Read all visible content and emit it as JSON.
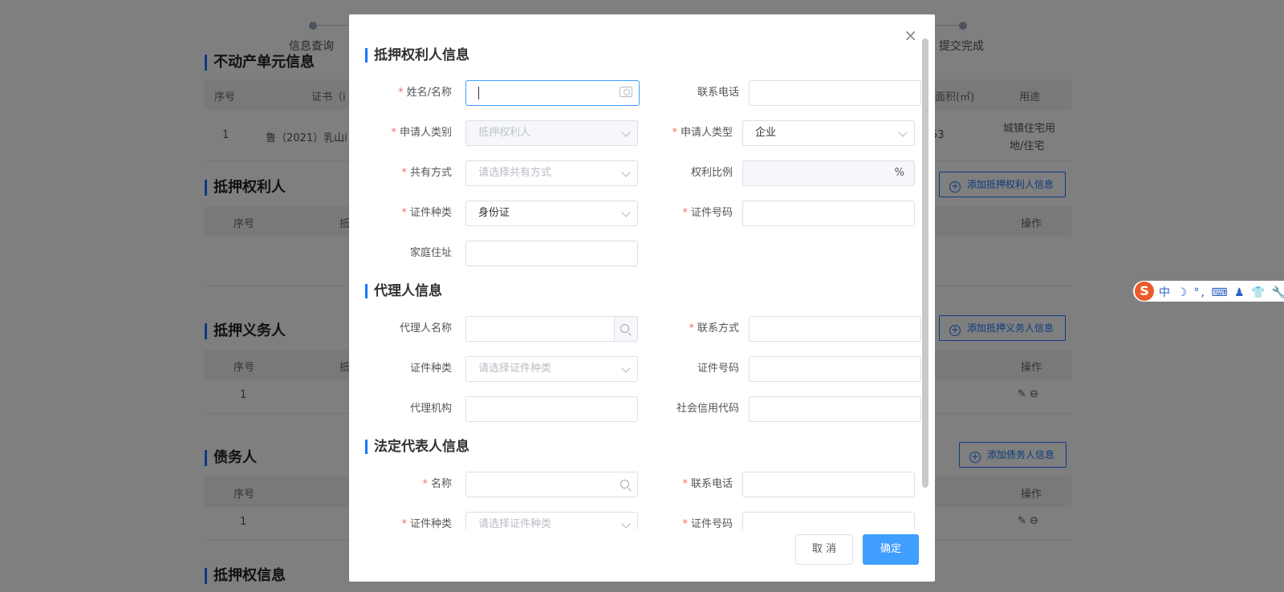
{
  "background": {
    "steps": [
      "信息查询",
      "提交完成"
    ],
    "sections": {
      "property_unit": {
        "title": "不动产单元信息",
        "columns": [
          "序号",
          "证书（i",
          "面积(㎡)",
          "用途"
        ],
        "row": [
          "1",
          "鲁（2021）乳山i",
          "53",
          "城镇住宅用",
          "地/住宅"
        ]
      },
      "mortgagee": {
        "title": "抵押权利人",
        "columns": [
          "序号",
          "抵",
          "操作"
        ],
        "add_button": "添加抵押权利人信息"
      },
      "mortgagor": {
        "title": "抵押义务人",
        "columns": [
          "序号",
          "抵",
          "操作"
        ],
        "row_index": "1",
        "add_button": "添加抵押义务人信息"
      },
      "debtor": {
        "title": "债务人",
        "columns": [
          "序号",
          "操作"
        ],
        "row_index": "1",
        "add_button": "添加债务人信息"
      },
      "mortgage_info": {
        "title": "抵押权信息"
      }
    }
  },
  "modal": {
    "section_mortgagee": {
      "title": "抵押权利人信息",
      "name_label": "姓名/名称",
      "name_value": "",
      "phone_label": "联系电话",
      "phone_value": "",
      "applicant_category_label": "申请人类别",
      "applicant_category_value": "抵押权利人",
      "applicant_type_label": "申请人类型",
      "applicant_type_value": "企业",
      "co_ownership_label": "共有方式",
      "co_ownership_placeholder": "请选择共有方式",
      "ratio_label": "权利比例",
      "ratio_unit": "%",
      "id_type_label": "证件种类",
      "id_type_value": "身份证",
      "id_number_label": "证件号码",
      "id_number_value": "",
      "address_label": "家庭住址",
      "address_value": ""
    },
    "section_agent": {
      "title": "代理人信息",
      "name_label": "代理人名称",
      "contact_label": "联系方式",
      "id_type_label": "证件种类",
      "id_type_placeholder": "请选择证件种类",
      "id_number_label": "证件号码",
      "org_label": "代理机构",
      "credit_code_label": "社会信用代码"
    },
    "section_legal_rep": {
      "title": "法定代表人信息",
      "name_label": "名称",
      "phone_label": "联系电话",
      "id_type_label": "证件种类",
      "id_type_placeholder": "请选择证件种类",
      "id_number_label": "证件号码"
    },
    "close_symbol": "×",
    "cancel_label": "取 消",
    "confirm_label": "确定",
    "required_mark": "*"
  },
  "ime_toolbar": {
    "logo": "S",
    "items": "中 ☽ °, ⌨ ♟ 👕 🔧"
  },
  "colors": {
    "primary": "#409eff",
    "required": "#f56c6c",
    "accent_bar": "#1677ff"
  }
}
